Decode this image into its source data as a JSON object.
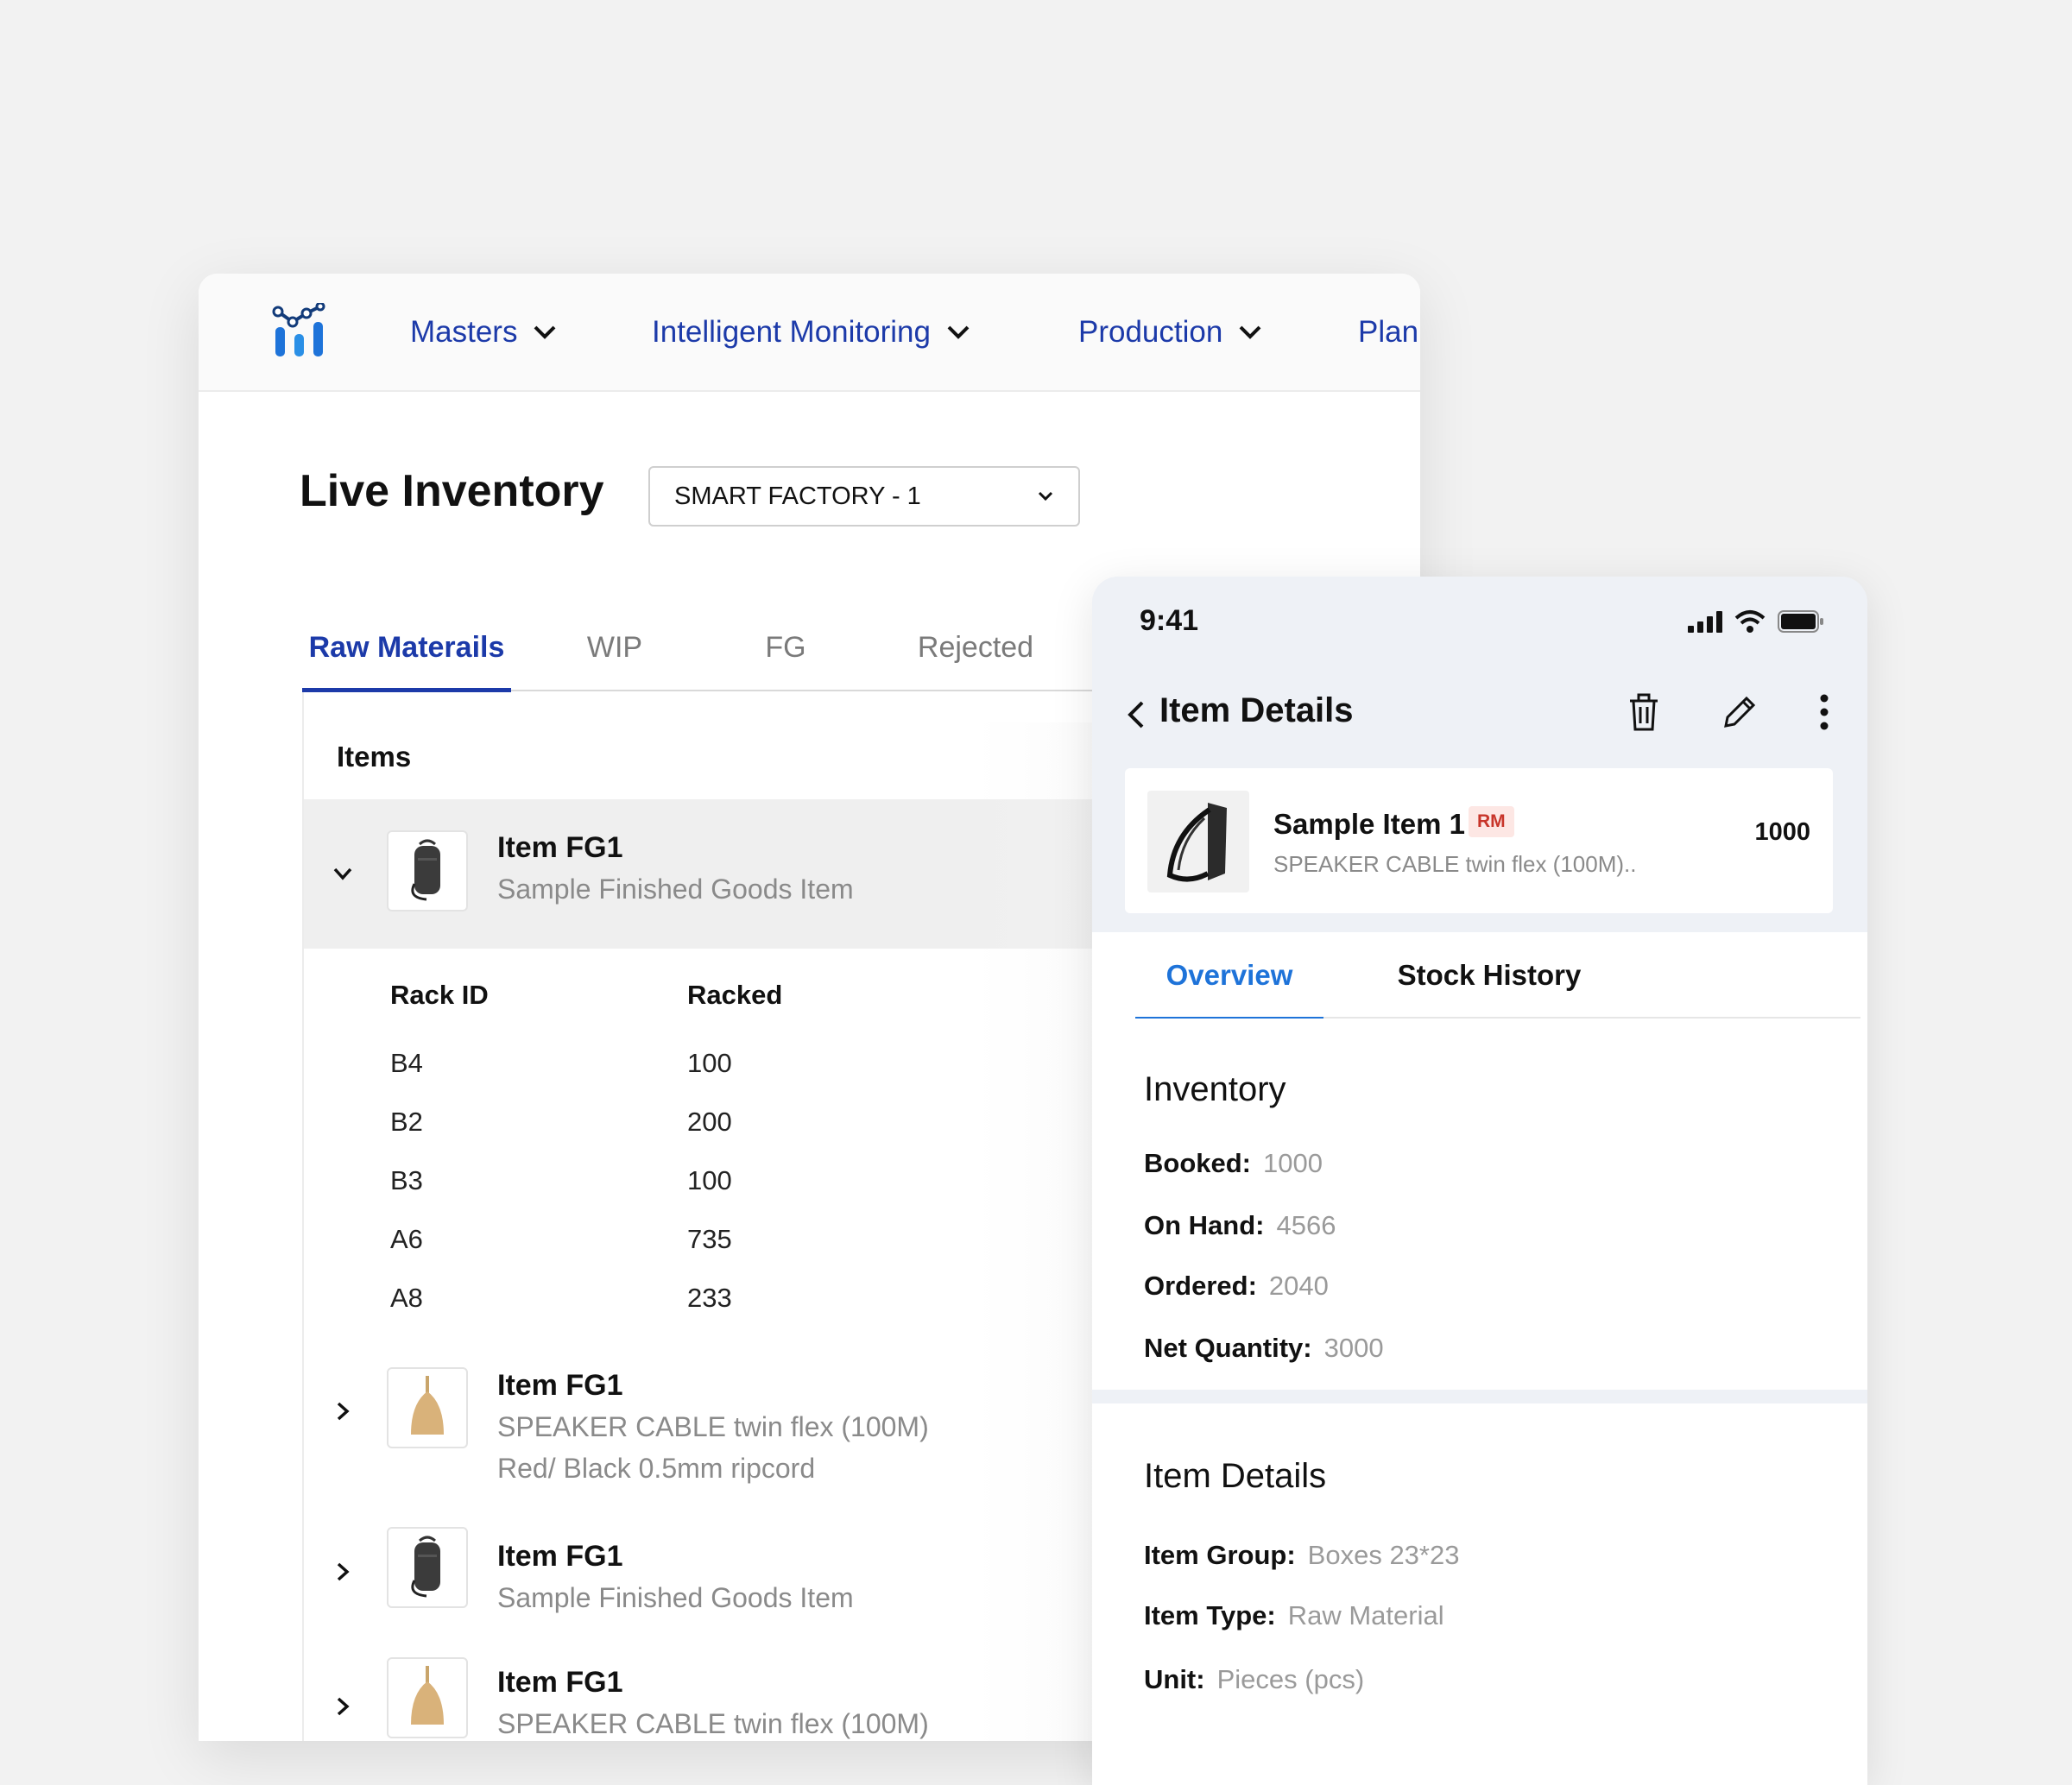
{
  "nav": {
    "items": [
      {
        "label": "Masters"
      },
      {
        "label": "Intelligent Monitoring"
      },
      {
        "label": "Production"
      },
      {
        "label": "Plan"
      }
    ]
  },
  "page": {
    "title": "Live Inventory",
    "factory_select": "SMART FACTORY - 1"
  },
  "tabs": [
    "Raw Materails",
    "WIP",
    "FG",
    "Rejected"
  ],
  "list": {
    "header": "Items",
    "expanded_item": {
      "name": "Item FG1",
      "desc": "Sample Finished Goods Item",
      "rack_headers": {
        "rack": "Rack ID",
        "racked": "Racked"
      },
      "racks": [
        {
          "id": "B4",
          "racked": "100"
        },
        {
          "id": "B2",
          "racked": "200"
        },
        {
          "id": "B3",
          "racked": "100"
        },
        {
          "id": "A6",
          "racked": "735"
        },
        {
          "id": "A8",
          "racked": "233"
        }
      ]
    },
    "items": [
      {
        "name": "Item FG1",
        "desc1": "SPEAKER CABLE twin flex (100M)",
        "desc2": "Red/ Black 0.5mm ripcord",
        "image": "wooden-board"
      },
      {
        "name": "Item FG1",
        "desc1": "Sample Finished Goods Item",
        "desc2": "",
        "image": "backpack"
      },
      {
        "name": "Item FG1",
        "desc1": "SPEAKER CABLE twin flex (100M)",
        "desc2": "",
        "image": "wooden-board"
      }
    ]
  },
  "phone": {
    "time": "9:41",
    "title": "Item Details",
    "card": {
      "name": "Sample Item 1",
      "badge": "RM",
      "desc": "SPEAKER CABLE twin flex (100M)..",
      "qty": "1000"
    },
    "tabs": {
      "overview": "Overview",
      "history": "Stock History"
    },
    "inventory": {
      "title": "Inventory",
      "rows": [
        {
          "k": "Booked:",
          "v": "1000"
        },
        {
          "k": "On Hand:",
          "v": "4566"
        },
        {
          "k": "Ordered:",
          "v": "2040"
        },
        {
          "k": "Net Quantity:",
          "v": "3000"
        }
      ]
    },
    "details": {
      "title": "Item Details",
      "rows": [
        {
          "k": "Item Group:",
          "v": "Boxes 23*23"
        },
        {
          "k": "Item Type:",
          "v": "Raw Material"
        },
        {
          "k": "Unit:",
          "v": "Pieces (pcs)"
        }
      ]
    }
  },
  "colors": {
    "brand": "#1c3aa9",
    "accent": "#1e73d9",
    "badge": "#c8352a"
  },
  "icons": [
    "logo-icon",
    "chevron-down-icon",
    "chevron-right-icon",
    "back-icon",
    "trash-icon",
    "pencil-icon",
    "more-vertical-icon",
    "signal-icon",
    "wifi-icon",
    "battery-icon"
  ]
}
